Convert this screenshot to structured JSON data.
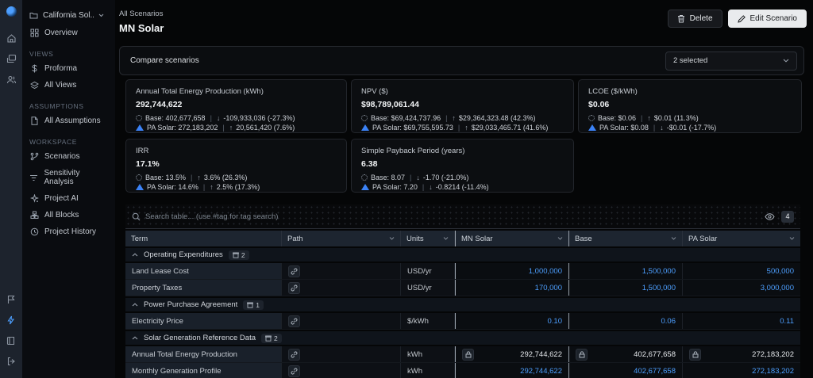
{
  "colors": {
    "accent_blue": "#4d9fff",
    "page_bg": "#050607",
    "table_header": "#1d2530",
    "highlight_column_border": "#99a1ab"
  },
  "ui": {
    "pipe": "|"
  },
  "sidebar": {
    "project": "California Sol...",
    "overview": "Overview",
    "sections": [
      {
        "title": "VIEWS",
        "items": [
          {
            "label": "Proforma"
          },
          {
            "label": "All Views"
          }
        ]
      },
      {
        "title": "ASSUMPTIONS",
        "items": [
          {
            "label": "All Assumptions"
          }
        ]
      },
      {
        "title": "WORKSPACE",
        "items": [
          {
            "label": "Scenarios"
          },
          {
            "label": "Sensitivity Analysis"
          },
          {
            "label": "Project AI"
          },
          {
            "label": "All Blocks"
          },
          {
            "label": "Project History"
          }
        ]
      }
    ]
  },
  "header": {
    "breadcrumb": "All Scenarios",
    "title": "MN Solar",
    "delete_label": "Delete",
    "edit_label": "Edit Scenario"
  },
  "compare": {
    "label": "Compare scenarios",
    "selected": "2 selected"
  },
  "kpis": [
    {
      "title": "Annual Total Energy Production (kWh)",
      "value": "292,744,622",
      "rows": [
        {
          "label": "Base: 402,677,658",
          "arrow": "↓",
          "delta": "-109,933,036 (-27.3%)"
        },
        {
          "label": "PA Solar: 272,183,202",
          "arrow": "↑",
          "delta": "20,561,420 (7.6%)"
        }
      ]
    },
    {
      "title": "NPV ($)",
      "value": "$98,789,061.44",
      "rows": [
        {
          "label": "Base: $69,424,737.96",
          "arrow": "↑",
          "delta": "$29,364,323.48 (42.3%)"
        },
        {
          "label": "PA Solar: $69,755,595.73",
          "arrow": "↑",
          "delta": "$29,033,465.71 (41.6%)"
        }
      ]
    },
    {
      "title": "LCOE ($/kWh)",
      "value": "$0.06",
      "rows": [
        {
          "label": "Base: $0.06",
          "arrow": "↑",
          "delta": "$0.01 (11.3%)"
        },
        {
          "label": "PA Solar: $0.08",
          "arrow": "↓",
          "delta": "-$0.01 (-17.7%)"
        }
      ]
    },
    {
      "title": "IRR",
      "value": "17.1%",
      "rows": [
        {
          "label": "Base: 13.5%",
          "arrow": "↑",
          "delta": "3.6% (26.3%)"
        },
        {
          "label": "PA Solar: 14.6%",
          "arrow": "↑",
          "delta": "2.5% (17.3%)"
        }
      ]
    },
    {
      "title": "Simple Payback Period (years)",
      "value": "6.38",
      "rows": [
        {
          "label": "Base: 8.07",
          "arrow": "↓",
          "delta": "-1.70 (-21.0%)"
        },
        {
          "label": "PA Solar: 7.20",
          "arrow": "↓",
          "delta": "-0.8214 (-11.4%)"
        }
      ]
    }
  ],
  "search": {
    "placeholder": "Search table... (use #tag for tag search)",
    "count": "4"
  },
  "table": {
    "columns": [
      "Term",
      "Path",
      "Units",
      "MN Solar",
      "Base",
      "PA Solar"
    ],
    "sections": [
      {
        "name": "Operating Expenditures",
        "count": "2",
        "rows": [
          {
            "term": "Land Lease Cost",
            "units": "USD/yr",
            "mn": "1,000,000",
            "base": "1,500,000",
            "pa": "500,000"
          },
          {
            "term": "Property Taxes",
            "units": "USD/yr",
            "mn": "170,000",
            "base": "1,500,000",
            "pa": "3,000,000"
          }
        ]
      },
      {
        "name": "Power Purchase Agreement",
        "count": "1",
        "rows": [
          {
            "term": "Electricity Price",
            "units": "$/kWh",
            "mn": "0.10",
            "base": "0.06",
            "pa": "0.11"
          }
        ]
      },
      {
        "name": "Solar Generation Reference Data",
        "count": "2",
        "rows": [
          {
            "term": "Annual Total Energy Production",
            "units": "kWh",
            "mn": "292,744,622",
            "base": "402,677,658",
            "pa": "272,183,202",
            "locked": true
          },
          {
            "term": "Monthly Generation Profile",
            "units": "kWh",
            "mn": "292,744,622",
            "base": "402,677,658",
            "pa": "272,183,202"
          }
        ]
      }
    ]
  }
}
